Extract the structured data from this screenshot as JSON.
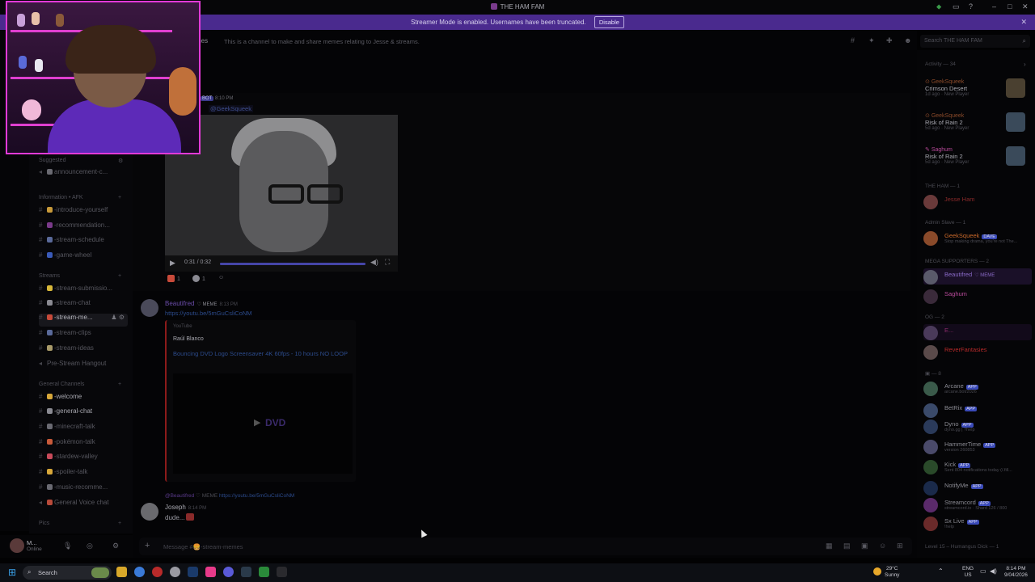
{
  "window": {
    "title": "THE HAM FAM"
  },
  "banner": {
    "text": "Streamer Mode is enabled. Usernames have been truncated.",
    "button": "Disable"
  },
  "topic": {
    "channel_name": "mes",
    "description": "This is a channel to make and share memes relating to Jesse & streams."
  },
  "search": {
    "placeholder": "Search THE HAM FAM"
  },
  "sidebar": {
    "categories": {
      "suggested": "Suggested",
      "information": "Information • AFK",
      "streams": "Streams",
      "general": "General Channels",
      "pics": "Pics"
    },
    "channels": [
      {
        "label": "announcement-c...",
        "color": "#6a6a72"
      },
      {
        "label": "-introduce-yourself",
        "color": "#c89a3a"
      },
      {
        "label": "-recommendation...",
        "color": "#7a3a8a"
      },
      {
        "label": "-stream-schedule",
        "color": "#5a6a9a"
      },
      {
        "label": "-game-wheel",
        "color": "#3a5ab8"
      },
      {
        "label": "-stream-submissio...",
        "color": "#d8b83a"
      },
      {
        "label": "-stream-chat",
        "color": "#8a8a92"
      },
      {
        "label": "-stream-me...",
        "color": "#c84a3a"
      },
      {
        "label": "-stream-clips",
        "color": "#5a6a9a"
      },
      {
        "label": "-stream-ideas",
        "color": "#a89a6a"
      },
      {
        "label": "Pre-Stream Hangout",
        "color": "#5a5a62"
      },
      {
        "label": "-welcome",
        "color": "#d8a83a"
      },
      {
        "label": "-general-chat",
        "color": "#8a8a92"
      },
      {
        "label": "-minecraft-talk",
        "color": "#6a6a72"
      },
      {
        "label": "-pokémon-talk",
        "color": "#c85a3a"
      },
      {
        "label": "-stardew-valley",
        "color": "#c84a5a"
      },
      {
        "label": "-spoiler-talk",
        "color": "#d8a83a"
      },
      {
        "label": "-music-recomme...",
        "color": "#6a6a72"
      },
      {
        "label": "General Voice chat",
        "color": "#b84a3a"
      }
    ]
  },
  "user": {
    "name": "M...",
    "status": "Online"
  },
  "messages": {
    "bot_tag": "BOT",
    "bot_time": "8:10 PM",
    "mention": "@GeekSqueek",
    "video": {
      "time": "0:31 / 0:32",
      "progress": 1.0
    },
    "reactions": [
      {
        "count": "1",
        "color": "#c84a3a"
      },
      {
        "count": "1",
        "color": "#8a8a92"
      }
    ],
    "beautifred": {
      "author": "Beautifred",
      "badge": "MEME",
      "time": "8:13 PM",
      "link": "https://youtu.be/5mGuCsliCoNM",
      "embed": {
        "provider": "YouTube",
        "author": "Raúl Blanco",
        "title": "Bouncing DVD Logo Screensaver 4K 60fps - 10 hours NO LOOP",
        "logo": "DVD"
      }
    },
    "joseph": {
      "reply_to": "@Beautifred",
      "reply_badge": "MEME",
      "reply_link": "https://youtu.be/5mGuCsliCoNM",
      "author": "Joseph",
      "time": "8:14 PM",
      "text": "dude..."
    }
  },
  "composer": {
    "placeholder": "Message #🍔-stream-memes"
  },
  "members": {
    "activity_header": "Activity — 34",
    "activities": [
      {
        "who": "GeekSqueek",
        "game": "Crimson Desert",
        "meta": "1d ago · New Player"
      },
      {
        "who": "GeekSqueek",
        "game": "Risk of Rain 2",
        "meta": "5d ago · New Player"
      },
      {
        "who": "Saghum",
        "game": "Risk of Rain 2",
        "meta": "5d ago · New Player"
      }
    ],
    "groups": {
      "ham": "THE HAM — 1",
      "admin": "Admin Slave — 1",
      "mega": "MEGA SUPPORTERS — 2",
      "og": "OG — 2",
      "bots": "— 8",
      "level": "Level 15 – Humangus Dick — 1"
    },
    "list": [
      {
        "name": "Jesse Ham",
        "color": "#8a2a2a",
        "status": ""
      },
      {
        "name": "GeekSqueek",
        "color": "#c8682a",
        "status": "Stop making drama, you're not The...",
        "badge": "DAVE"
      },
      {
        "name": "Beautifred",
        "color": "#8a6ac8",
        "status": "",
        "badge": "MEME"
      },
      {
        "name": "Saghum",
        "color": "#b84a9a",
        "status": ""
      },
      {
        "name": "E...",
        "color": "#8a2a6a",
        "status": ""
      },
      {
        "name": "ReverFantasies",
        "color": "#b82a2a",
        "status": ""
      },
      {
        "name": "Arcane",
        "color": "#8a8a92",
        "status": "arcane.bot/2026",
        "badge": "APP"
      },
      {
        "name": "BetRix",
        "color": "#8a8a92",
        "status": "",
        "badge": "APP"
      },
      {
        "name": "Dyno",
        "color": "#8a8a92",
        "status": "dyno.gg | ?help",
        "badge": "APP"
      },
      {
        "name": "HammerTime",
        "color": "#8a8a92",
        "status": "version 260853",
        "badge": "APP"
      },
      {
        "name": "Kick",
        "color": "#8a8a92",
        "status": "Sent 804 notifications today (/.fill...",
        "badge": "APP"
      },
      {
        "name": "NotifyMe",
        "color": "#8a8a92",
        "status": "",
        "badge": "APP"
      },
      {
        "name": "Streamcord",
        "color": "#8a8a92",
        "status": "streamcord.io · Shard 126 / 800",
        "badge": "APP"
      },
      {
        "name": "Sx Live",
        "color": "#8a8a92",
        "status": "!help",
        "badge": "APP"
      }
    ]
  },
  "taskbar": {
    "search": "Search",
    "weather": {
      "temp": "29°C",
      "cond": "Sunny"
    },
    "lang": {
      "l1": "ENG",
      "l2": "US"
    },
    "clock": {
      "time": "8:14 PM",
      "date": "9/04/2026"
    }
  }
}
